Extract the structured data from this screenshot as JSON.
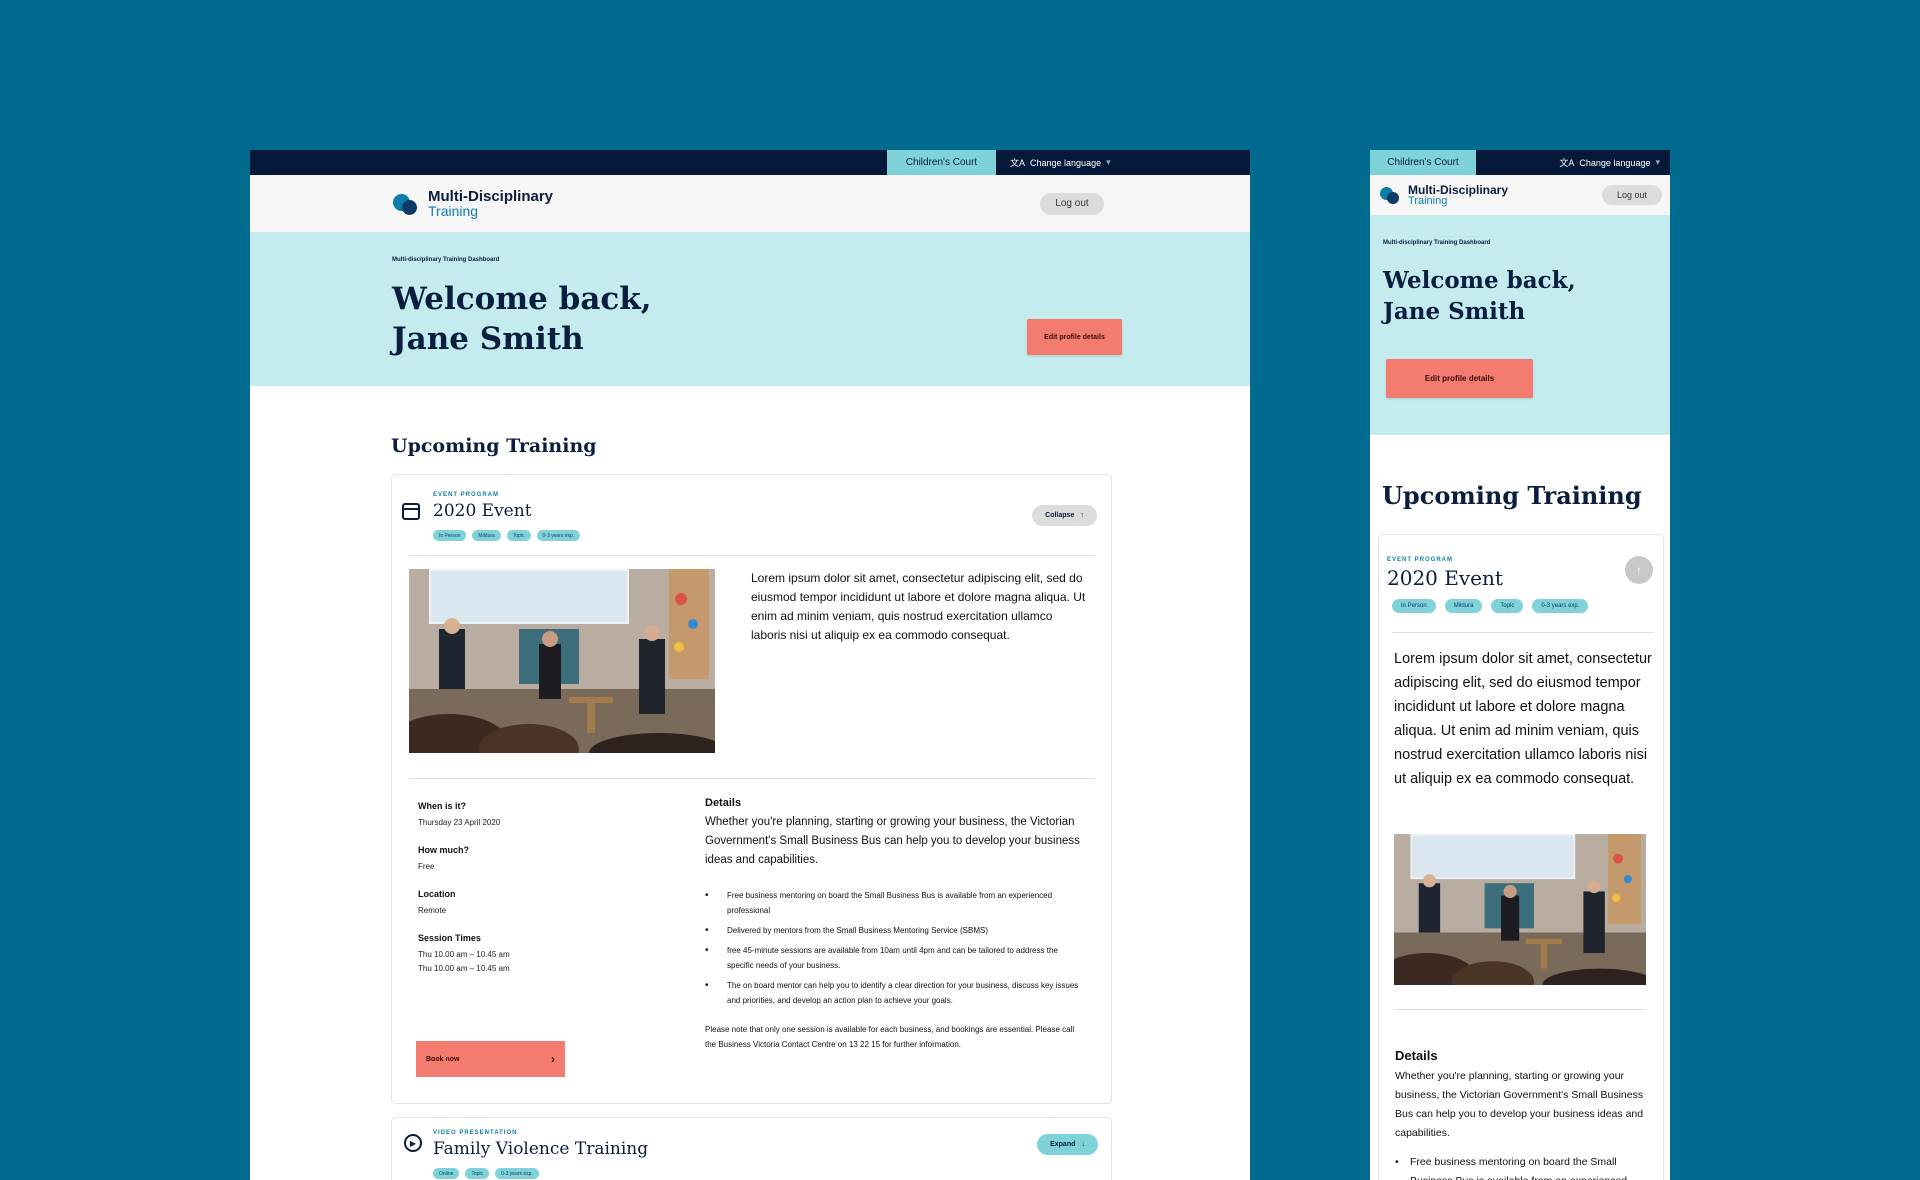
{
  "colors": {
    "background": "#006a8f",
    "topbar": "#06193a",
    "court_tab": "#7fd3d8",
    "hero": "#c4ebed",
    "accent_button": "#f47b6f",
    "tag": "#7fd3d8",
    "heading": "#0b1e3f"
  },
  "topbar": {
    "court_tab_label": "Children's Court",
    "change_language_label": "Change language",
    "translate_icon": "translate-icon",
    "chevron_icon": "chevron-down-icon"
  },
  "header": {
    "logo_line1": "Multi-Disciplinary",
    "logo_line2": "Training",
    "logout_label": "Log out"
  },
  "hero": {
    "breadcrumb": "Multi-disciplinary Training Dashboard",
    "welcome_line1": "Welcome back,",
    "welcome_line2": "Jane Smith",
    "edit_profile_label": "Edit profile details"
  },
  "upcoming": {
    "section_title": "Upcoming Training",
    "event1": {
      "eyebrow": "EVENT PROGRAM",
      "title": "2020 Event",
      "icon": "calendar-icon",
      "tags": [
        "In Person",
        "Mildura",
        "Topic",
        "0-3 years exp."
      ],
      "collapse_label": "Collapse",
      "intro": "Lorem ipsum dolor sit amet, consectetur adipiscing elit, sed do eiusmod tempor incididunt ut labore et dolore magna aliqua. Ut enim ad minim veniam, quis nostrud exercitation ullamco laboris nisi ut aliquip ex ea commodo consequat.",
      "facts": [
        {
          "label": "When is it?",
          "values": [
            "Thursday 23 April 2020"
          ]
        },
        {
          "label": "How much?",
          "values": [
            "Free"
          ]
        },
        {
          "label": "Location",
          "values": [
            "Remote"
          ]
        },
        {
          "label": "Session Times",
          "values": [
            "Thu 10.00 am – 10.45 am",
            "Thu 10.00 am – 10.45 am"
          ]
        }
      ],
      "book_label": "Book now",
      "details_heading": "Details",
      "details_body": "Whether you're planning, starting or growing your business, the Victorian Government's Small Business Bus can help you to develop your business ideas and capabilities.",
      "details_bullets": [
        "Free business mentoring on board the Small Business Bus is available from an experienced professional",
        "Delivered by mentors from the Small Business Mentoring Service (SBMS)",
        "free 45-minute sessions are available from 10am until 4pm and can be tailored to address the specific needs of your business.",
        "The on board mentor can help you to identify a clear direction for your business, discuss key issues and priorities, and develop an action plan to achieve your goals."
      ],
      "details_note": "Please note that only one session is available for each business, and bookings are essential. Please call the Business Victoria Contact Centre on 13 22 15 for further information."
    },
    "event2": {
      "eyebrow": "VIDEO PRESENTATION",
      "title": "Family Violence Training",
      "icon": "play-circle-icon",
      "tags": [
        "Online",
        "Topic",
        "0-3 years exp."
      ],
      "expand_label": "Expand"
    }
  },
  "mobile": {
    "details_bullet_first": "Free business mentoring on board the Small Business Bus is available from an experienced"
  }
}
